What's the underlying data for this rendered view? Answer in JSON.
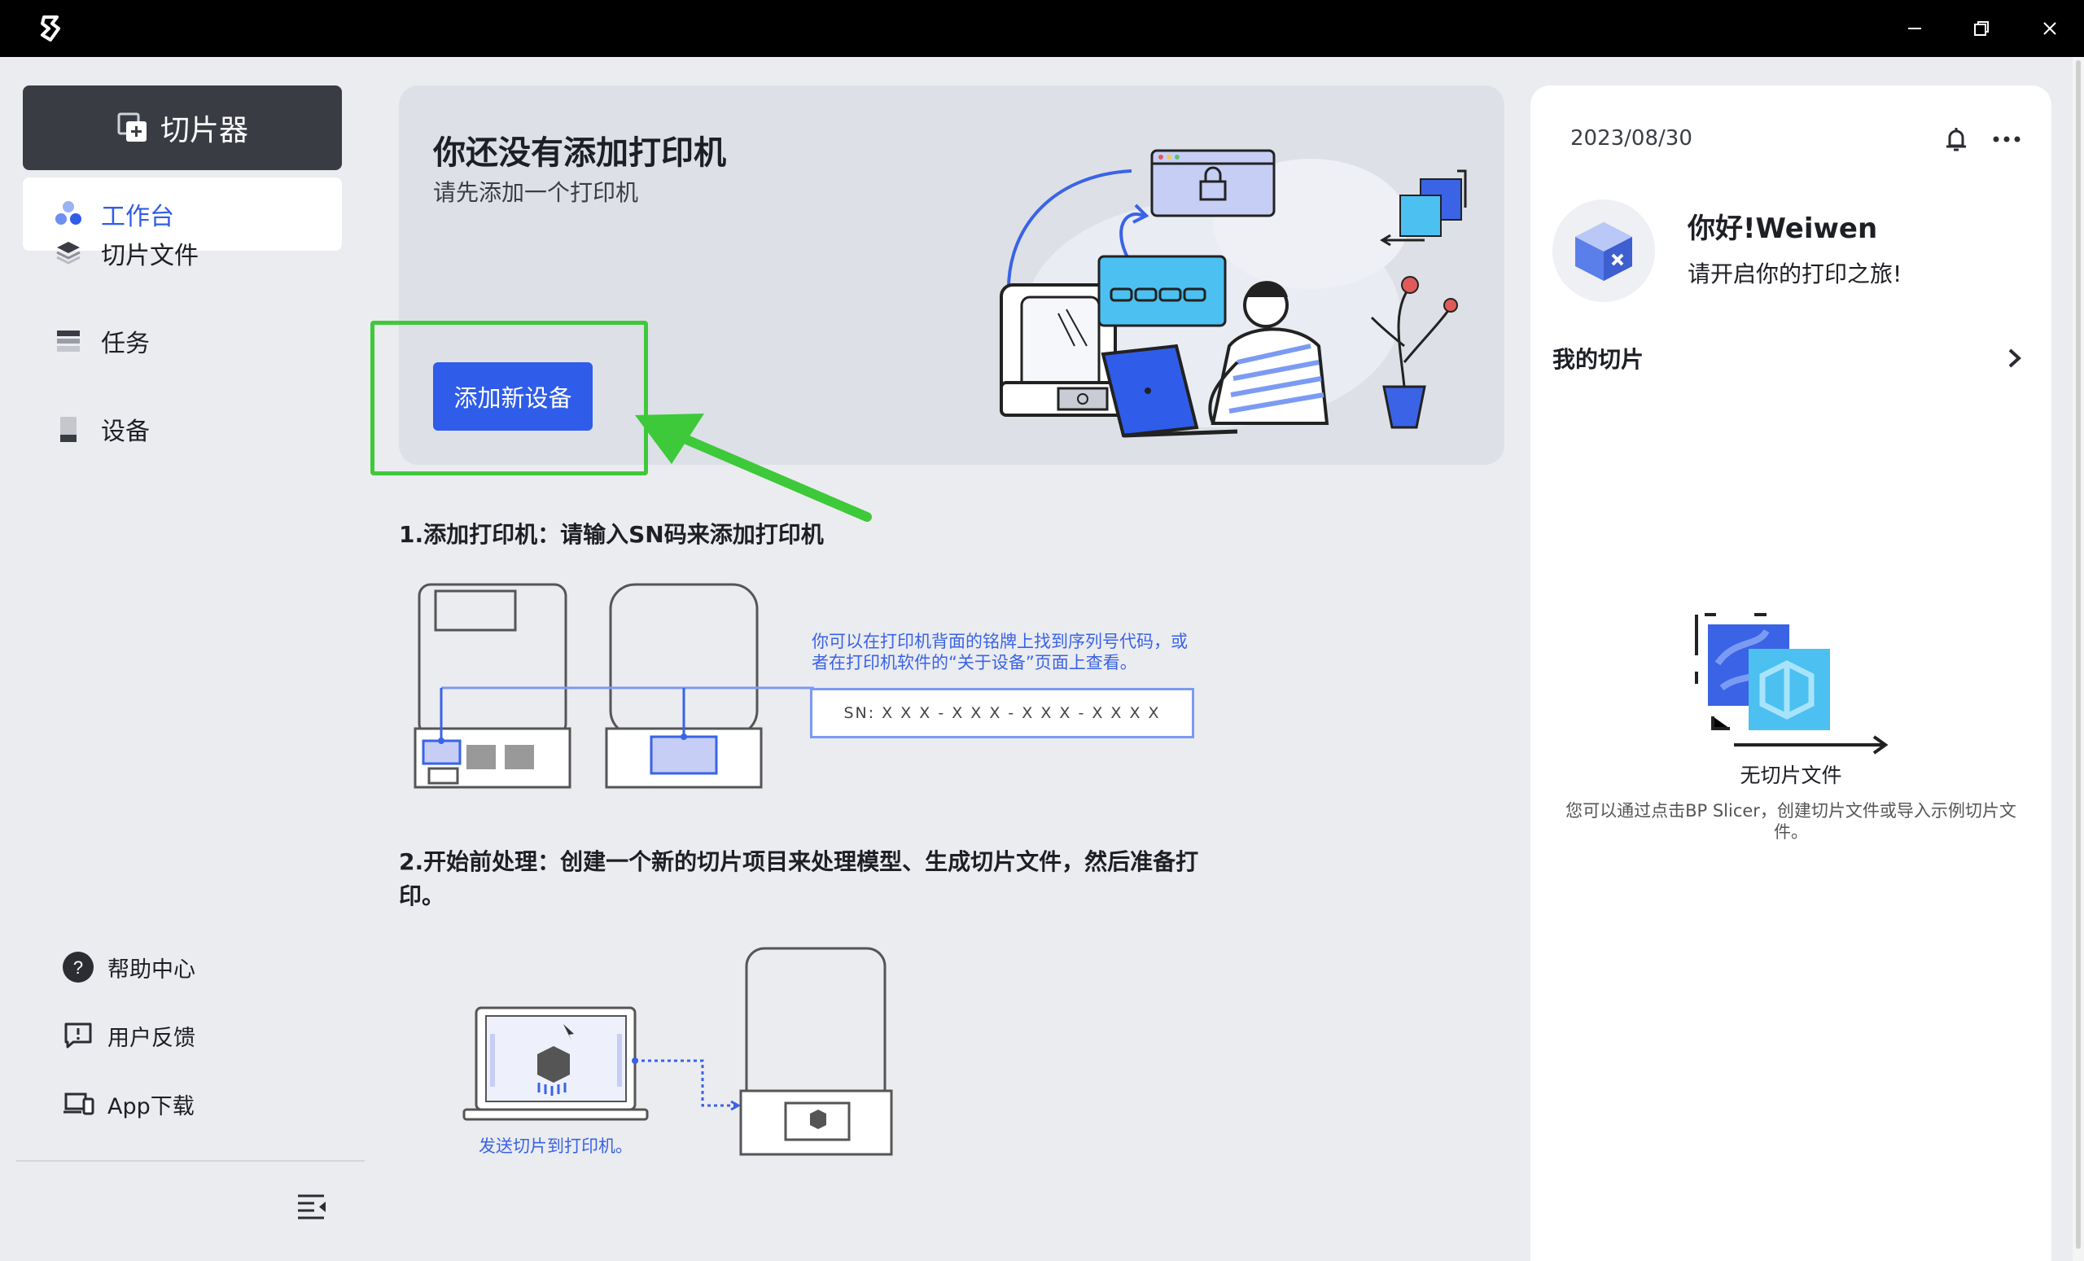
{
  "titlebar": {
    "controls": {
      "minimize": "minimize-icon",
      "restore": "restore-icon",
      "close": "close-icon"
    }
  },
  "sidebar": {
    "slicer_label": "切片器",
    "nav": [
      {
        "label": "工作台",
        "icon": "workbench-icon",
        "active": true
      },
      {
        "label": "切片文件",
        "icon": "layers-icon",
        "active": false
      },
      {
        "label": "任务",
        "icon": "task-list-icon",
        "active": false
      },
      {
        "label": "设备",
        "icon": "device-icon",
        "active": false
      }
    ],
    "bottom": [
      {
        "label": "帮助中心",
        "icon": "help-icon"
      },
      {
        "label": "用户反馈",
        "icon": "feedback-icon"
      },
      {
        "label": "App下载",
        "icon": "devices-download-icon"
      }
    ]
  },
  "hero": {
    "title": "你还没有添加打印机",
    "subtitle": "请先添加一个打印机",
    "add_button": "添加新设备"
  },
  "steps": {
    "step1_title": "1.添加打印机：请输入SN码来添加打印机",
    "step1_note_line1": "你可以在打印机背面的铭牌上找到序列号代码，或",
    "step1_note_line2": "者在打印机软件的“关于设备”页面上查看。",
    "sn_label": "SN: X X X - X X X - X X X - X X X X",
    "step2_title_line1": "2.开始前处理：创建一个新的切片项目来处理模型、生成切片文件，然后准备打",
    "step2_title_line2": "印。",
    "step2_note": "发送切片到打印机。"
  },
  "right_panel": {
    "date": "2023/08/30",
    "greeting": "你好!Weiwen",
    "greeting_sub": "请开启你的打印之旅!",
    "my_slices": "我的切片",
    "empty_title": "无切片文件",
    "empty_desc_line1": "您可以通过点击BP Slicer，创建切片文件或导入示例切片文",
    "empty_desc_line2": "件。"
  },
  "colors": {
    "accent": "#2f5ce8",
    "highlight": "#3ec93a",
    "titlebar": "#000000",
    "slicer_button": "#3a3c43"
  }
}
